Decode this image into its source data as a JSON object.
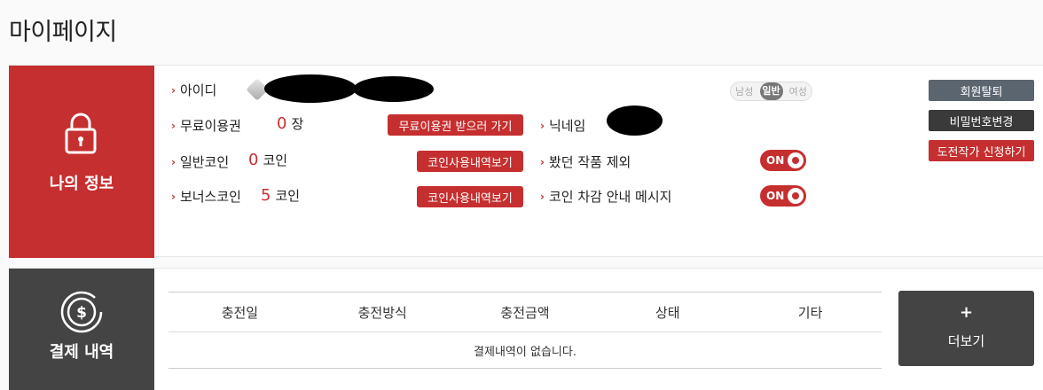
{
  "page": {
    "title": "마이페이지"
  },
  "info": {
    "side_label": "나의 정보",
    "id_label": "아이디",
    "free_pass_label": "무료이용권",
    "free_pass_count": "0",
    "free_pass_unit": "장",
    "free_pass_button": "무료이용권 받으러 가기",
    "normal_coin_label": "일반코인",
    "normal_coin_count": "0",
    "normal_coin_unit": "코인",
    "normal_coin_button": "코인사용내역보기",
    "bonus_coin_label": "보너스코인",
    "bonus_coin_count": "5",
    "bonus_coin_unit": "코인",
    "bonus_coin_button": "코인사용내역보기",
    "nickname_label": "닉네임",
    "exclude_viewed_label": "봤던 작품 제외",
    "exclude_viewed_toggle": "ON",
    "coin_notice_label": "코인 차감 안내 메시지",
    "coin_notice_toggle": "ON",
    "gender": {
      "options": [
        "남성",
        "일반",
        "여성"
      ],
      "selected": "일반"
    },
    "buttons": {
      "withdraw": "회원탈퇴",
      "change_password": "비밀번호변경",
      "apply_challenge": "도전작가 신청하기"
    }
  },
  "payment": {
    "side_label": "결제 내역",
    "columns": [
      "충전일",
      "충전방식",
      "충전금액",
      "상태",
      "기타"
    ],
    "empty_message": "결제내역이 없습니다.",
    "more_plus": "+",
    "more_label": "더보기"
  },
  "colors": {
    "accent_red": "#c62f2f",
    "dark_gray": "#444444",
    "slate": "#5b6570"
  },
  "icons": {
    "info": "lock-icon",
    "payment": "dollar-circle-icon"
  }
}
